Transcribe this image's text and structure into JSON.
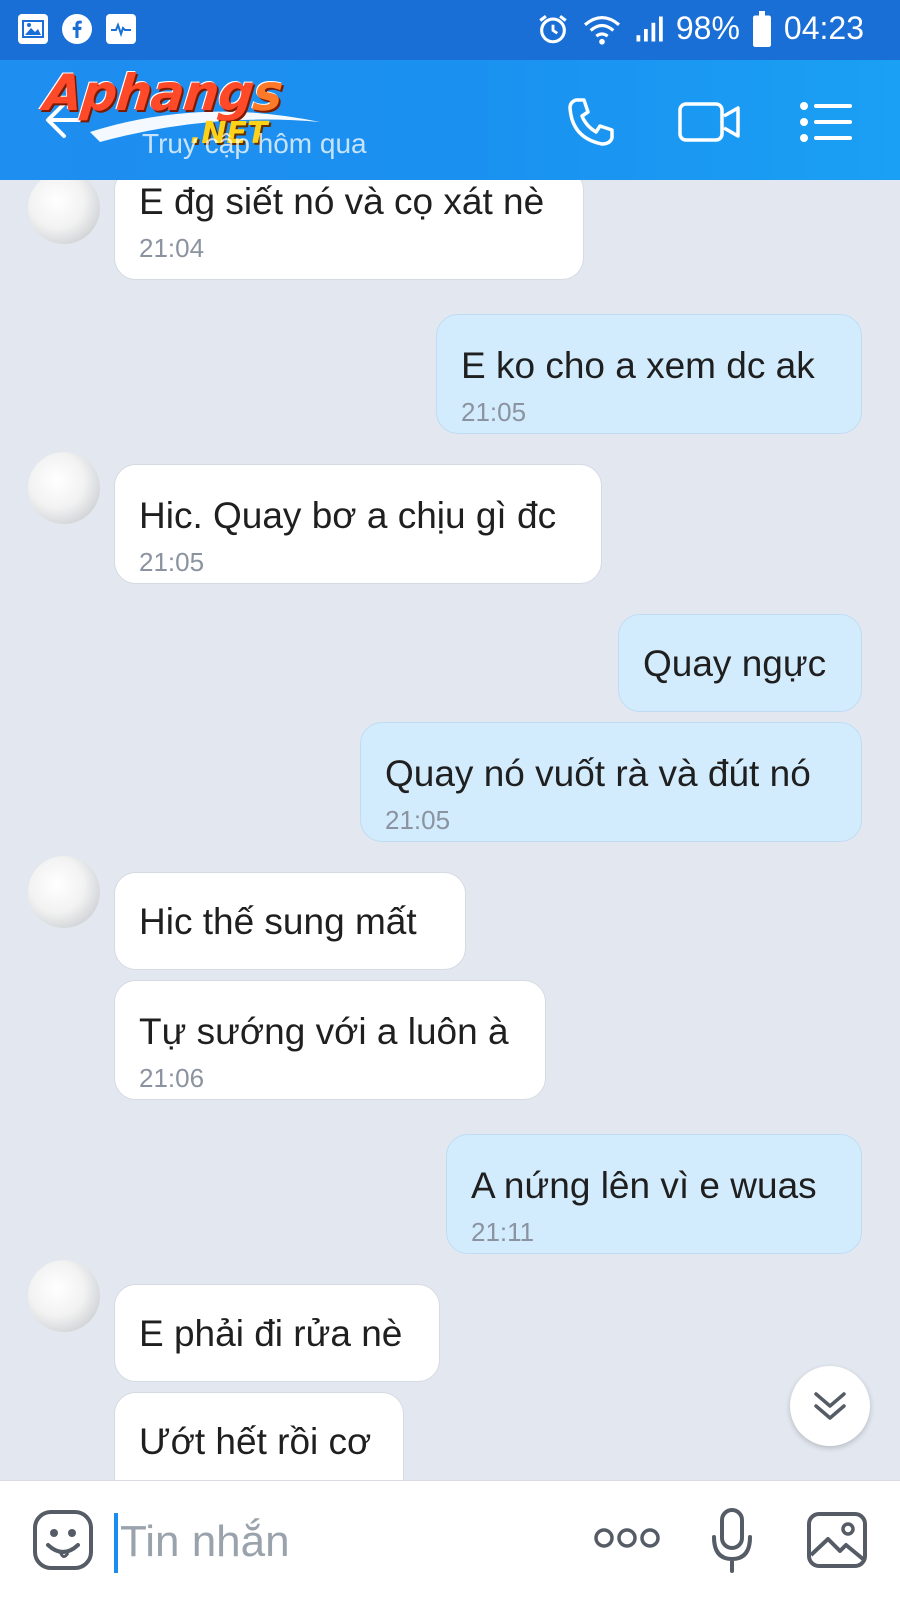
{
  "status_bar": {
    "battery_percent": "98%",
    "time": "04:23",
    "left_icons": [
      "gallery-icon",
      "facebook-icon",
      "activity-icon"
    ],
    "right_icons": [
      "alarm-icon",
      "wifi-icon",
      "signal-icon",
      "battery-icon"
    ]
  },
  "header": {
    "logo_main": "Aphang",
    "logo_tail": "s",
    "logo_net": ".NET",
    "subtitle": "Truy cập hôm qua",
    "buttons": [
      "phone-icon",
      "video-icon",
      "menu-icon"
    ]
  },
  "messages": [
    {
      "side": "in",
      "text": "E đg siết nó và cọ xát nè",
      "time": "21:04"
    },
    {
      "side": "out",
      "text": "E ko cho a xem dc ak",
      "time": "21:05"
    },
    {
      "side": "in",
      "text": "Hic. Quay bơ a chịu gì đc",
      "time": "21:05"
    },
    {
      "side": "out",
      "text": "Quay ngực",
      "time": ""
    },
    {
      "side": "out",
      "text": "Quay nó vuốt rà và đút nó",
      "time": "21:05"
    },
    {
      "side": "in",
      "text": "Hic thế sung mất",
      "time": ""
    },
    {
      "side": "in",
      "text": "Tự sướng với a luôn à",
      "time": "21:06"
    },
    {
      "side": "out",
      "text": "A nứng lên vì e wuas",
      "time": "21:11"
    },
    {
      "side": "in",
      "text": "E phải đi rửa nè",
      "time": ""
    },
    {
      "side": "in",
      "text": "Ướt hết rồi cơ",
      "time": ""
    }
  ],
  "input": {
    "placeholder": "Tin nhắn"
  },
  "colors": {
    "status_bar": "#1a6fd6",
    "header": "#1e8ef0",
    "chat_bg": "#e3e8f0",
    "incoming_bubble": "#ffffff",
    "outgoing_bubble": "#d3ecfd"
  }
}
